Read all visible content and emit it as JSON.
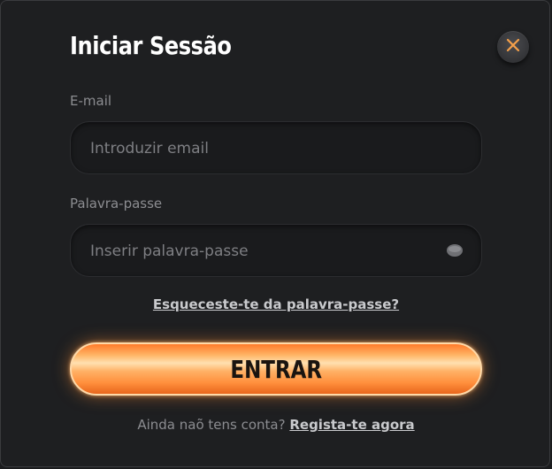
{
  "dialog": {
    "title": "Iniciar Sessão"
  },
  "email": {
    "label": "E-mail",
    "placeholder": "Introduzir email",
    "value": ""
  },
  "password": {
    "label": "Palavra-passe",
    "placeholder": "Inserir palavra-passe",
    "value": ""
  },
  "forgot_password": {
    "label": "Esqueceste-te da palavra-passe?"
  },
  "submit": {
    "label": "ENTRAR"
  },
  "signup": {
    "prompt": "Ainda naõ tens conta?",
    "link_label": "Regista-te agora"
  },
  "colors": {
    "accent": "#ff8f3c",
    "close_icon": "#f5a04a",
    "background": "#1e1f21"
  },
  "icons": {
    "close": "close-icon",
    "eye": "eye-icon"
  }
}
